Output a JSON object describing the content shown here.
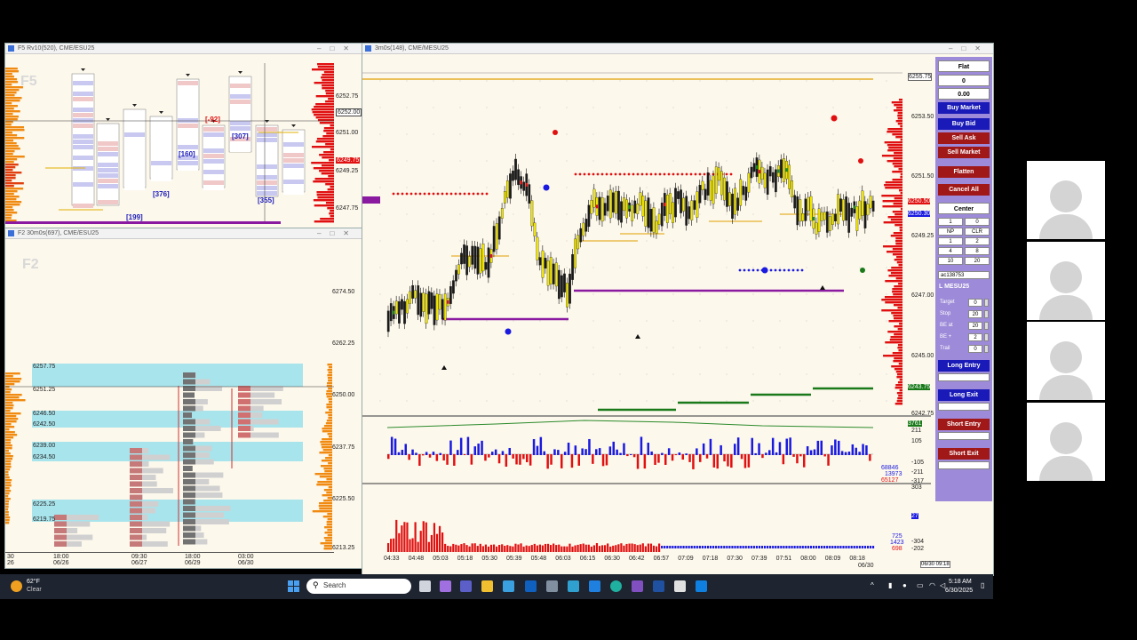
{
  "windows": {
    "f5": {
      "title": "F5 Rv10(520), CME/ESU25",
      "label": "F5",
      "prices": [
        "6252.75",
        "6251.00",
        "6249.25",
        "6247.75"
      ],
      "current_price": "6249.75",
      "box_price": "6252.00",
      "tags": [
        "[-92]",
        "[160]",
        "[307]",
        "[376]",
        "[199]",
        "[355]"
      ]
    },
    "f2": {
      "title": "F2 30m0s(697), CME/ESU25",
      "label": "F2",
      "prices": [
        "6274.50",
        "6262.25",
        "6250.00",
        "6237.75",
        "6225.50",
        "6213.25"
      ],
      "levels": [
        "6257.75",
        "6251.25",
        "6246.50",
        "6242.50",
        "6239.00",
        "6234.50",
        "6225.25",
        "6219.75"
      ],
      "dates": [
        [
          "18:00",
          "06/26"
        ],
        [
          "09:30",
          "06/27"
        ],
        [
          "18:00",
          "06/29"
        ],
        [
          "03:00",
          "06/30"
        ]
      ],
      "left_date": [
        "30",
        "26"
      ]
    },
    "main": {
      "title": "3m0s(148), CME/MESU25",
      "prices": [
        "6253.50",
        "6251.50",
        "6249.25",
        "6247.00",
        "6245.00",
        "6242.75"
      ],
      "tag_top": "6255.75",
      "tag_red": "6250.50",
      "tag_blue": "6250.30",
      "tag_green": "6243.75",
      "ind_top": "3761",
      "ind_labels": [
        "211",
        "105",
        "-105",
        "-211",
        "-317"
      ],
      "ind_values": [
        "68846",
        "13973",
        "65127"
      ],
      "vol_labels": [
        "303",
        "27",
        "725",
        "1423",
        "698",
        "-304",
        "-202"
      ],
      "times": [
        "04:33",
        "04:48",
        "05:03",
        "05:18",
        "05:30",
        "05:39",
        "05:48",
        "06:03",
        "06:15",
        "06:30",
        "06:42",
        "06:57",
        "07:09",
        "07:18",
        "07:30",
        "07:39",
        "07:51",
        "08:00",
        "08:09",
        "08:18"
      ],
      "last_date": "06/30",
      "corner_time": "06/30 09:18"
    }
  },
  "panel": {
    "position": "Flat",
    "qty": "0",
    "pnl": "0.00",
    "buy_market": "Buy Market",
    "buy_bid": "Buy Bid",
    "sell_ask": "Sell Ask",
    "sell_market": "Sell Market",
    "flatten": "Flatten",
    "cancel_all": "Cancel All",
    "center": "Center",
    "grid": [
      [
        "1",
        "0"
      ],
      [
        "NP",
        "CLR"
      ],
      [
        "1",
        "2"
      ],
      [
        "4",
        "8"
      ],
      [
        "10",
        "20"
      ]
    ],
    "account": "ac138753",
    "instrument": "L MESU25",
    "settings": [
      {
        "label": "Target",
        "value": "0"
      },
      {
        "label": "Stop",
        "value": "20"
      },
      {
        "label": "BE at",
        "value": "20"
      },
      {
        "label": "BE +",
        "value": "2"
      },
      {
        "label": "Trail",
        "value": "0"
      }
    ],
    "long_entry": "Long Entry",
    "long_exit": "Long Exit",
    "short_entry": "Short Entry",
    "short_exit": "Short Exit"
  },
  "taskbar": {
    "temperature": "62°F",
    "weather": "Clear",
    "search": "Search",
    "time": "5:18 AM",
    "date": "6/30/2025"
  },
  "colors": {
    "bull": "#f2e600",
    "bear": "#1a1a1a",
    "red": "#e01010",
    "blue": "#1a1ae0",
    "purple": "#8a1aa0",
    "green": "#1a7a1a",
    "panel": "#9d8ad8"
  }
}
